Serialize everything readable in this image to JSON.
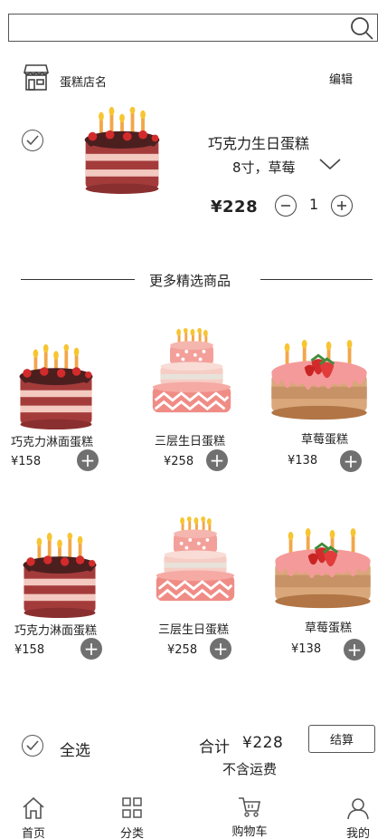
{
  "search": {
    "placeholder": ""
  },
  "shop": {
    "name": "蛋糕店名",
    "edit_label": "编辑"
  },
  "cart_item": {
    "title": "巧克力生日蛋糕",
    "spec": "8寸，草莓",
    "price": "¥228",
    "quantity": "1",
    "checked": true
  },
  "recommend": {
    "title": "更多精选商品",
    "products": [
      {
        "name": "巧克力淋面蛋糕",
        "price": "¥158",
        "cake": "chocolate"
      },
      {
        "name": "三层生日蛋糕",
        "price": "¥258",
        "cake": "tiered-pink"
      },
      {
        "name": "草莓蛋糕",
        "price": "¥138",
        "cake": "strawberry"
      },
      {
        "name": "巧克力淋面蛋糕",
        "price": "¥158",
        "cake": "chocolate"
      },
      {
        "name": "三层生日蛋糕",
        "price": "¥258",
        "cake": "tiered-pink"
      },
      {
        "name": "草莓蛋糕",
        "price": "¥138",
        "cake": "strawberry"
      }
    ]
  },
  "footer": {
    "select_all_label": "全选",
    "total_label": "合计",
    "total_value": "¥228",
    "shipping_note": "不含运费",
    "checkout_label": "结算"
  },
  "tabbar": {
    "items": [
      {
        "label": "首页",
        "icon": "home-icon"
      },
      {
        "label": "分类",
        "icon": "grid-icon"
      },
      {
        "label": "购物车",
        "icon": "cart-icon"
      },
      {
        "label": "我的",
        "icon": "user-icon"
      }
    ]
  },
  "colors": {
    "accent": "#707070",
    "border": "#555555",
    "text": "#222222"
  }
}
